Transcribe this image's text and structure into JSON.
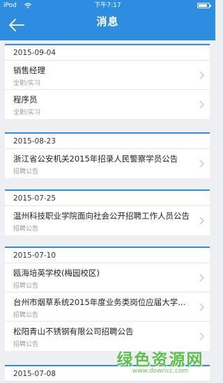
{
  "status_bar": {
    "carrier": "iPod",
    "time": "下午7:17",
    "battery_level": 0.85
  },
  "nav": {
    "title": "消息",
    "back_icon": "arrow-left-icon"
  },
  "groups": [
    {
      "date": "2015-09-04",
      "items": [
        {
          "title": "销售经理",
          "subtitle": "全职/实习"
        },
        {
          "title": "程序员",
          "subtitle": "全职/实习"
        }
      ]
    },
    {
      "date": "2015-08-23",
      "items": [
        {
          "title": "浙江省公安机关2015年招录人民警察学员公告",
          "subtitle": "招聘公告"
        }
      ]
    },
    {
      "date": "2015-07-25",
      "items": [
        {
          "title": "温州科技职业学院面向社会公开招聘工作人员公告",
          "subtitle": "招聘公告"
        }
      ]
    },
    {
      "date": "2015-07-10",
      "items": [
        {
          "title": "瓯海培英学校(梅园校区)",
          "subtitle": "招聘公告"
        },
        {
          "title": "台州市烟草系统2015年度业务类岗位应届大学...",
          "subtitle": "招聘公告"
        },
        {
          "title": "松阳青山不锈钢有限公司招聘公告",
          "subtitle": "招聘公告"
        }
      ]
    },
    {
      "date": "2015-07-08",
      "items": []
    }
  ],
  "watermark": {
    "big": "绿色资源网",
    "small": "www.downcc.com"
  },
  "colors": {
    "accent": "#2f8de0",
    "background": "#eeeff3",
    "watermark": "#5cc14a"
  }
}
